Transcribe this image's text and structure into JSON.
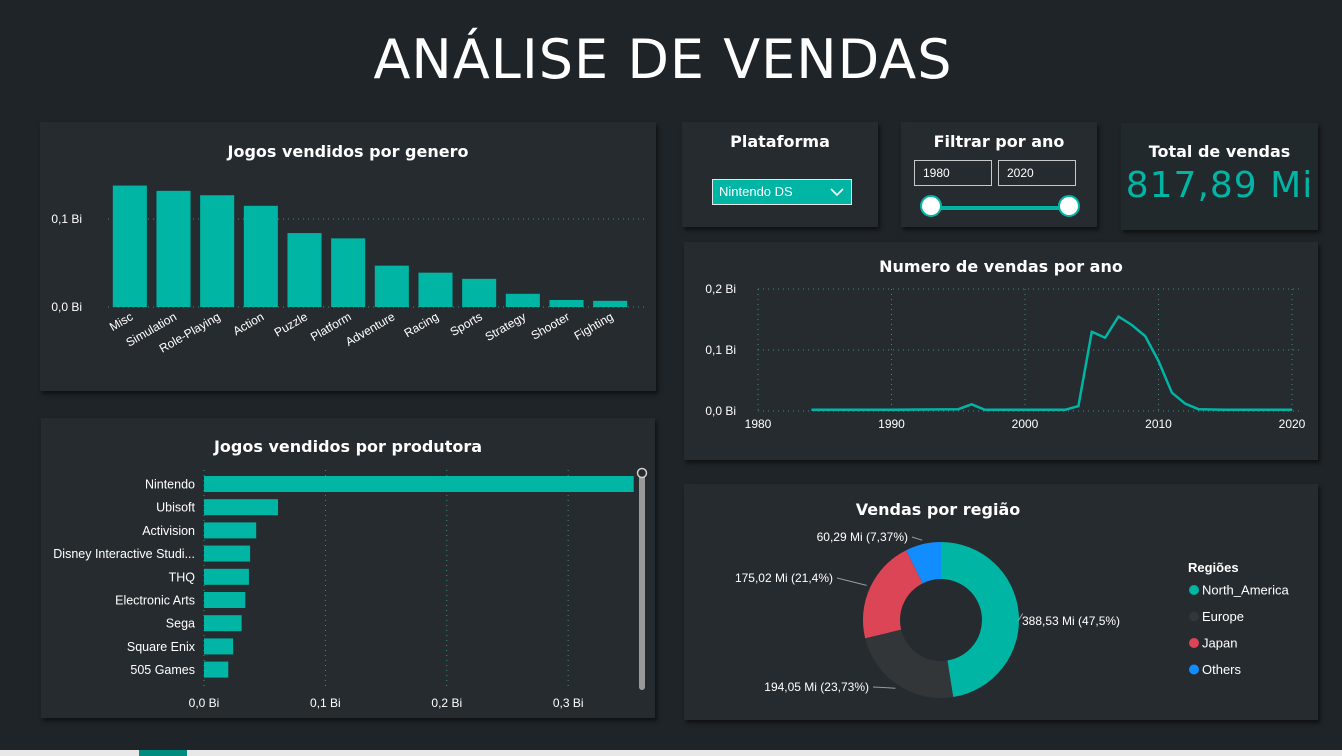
{
  "page_title": "ANÁLISE DE VENDAS",
  "colors": {
    "accent": "#00b5a4",
    "background": "#1f2428",
    "card": "#262b30"
  },
  "platform_filter": {
    "title": "Plataforma",
    "selected": "Nintendo DS",
    "icon": "chevron-down-icon"
  },
  "year_filter": {
    "title": "Filtrar por ano",
    "from": "1980",
    "to": "2020",
    "range": [
      1980,
      2020
    ]
  },
  "kpi": {
    "title": "Total de vendas",
    "value": "817,89 Mi"
  },
  "chart_data": [
    {
      "id": "genre",
      "type": "bar",
      "title": "Jogos vendidos por genero",
      "categories": [
        "Misc",
        "Simulation",
        "Role-Playing",
        "Action",
        "Puzzle",
        "Platform",
        "Adventure",
        "Racing",
        "Sports",
        "Strategy",
        "Shooter",
        "Fighting"
      ],
      "values": [
        0.138,
        0.132,
        0.127,
        0.115,
        0.084,
        0.078,
        0.047,
        0.039,
        0.032,
        0.015,
        0.008,
        0.007
      ],
      "yticks": [
        "0,0 Bi",
        "0,1 Bi"
      ],
      "ylim": [
        0,
        0.14
      ],
      "grid": true
    },
    {
      "id": "publisher",
      "type": "bar",
      "orientation": "horizontal",
      "title": "Jogos vendidos por produtora",
      "categories": [
        "Nintendo",
        "Ubisoft",
        "Activision",
        "Disney Interactive Studi...",
        "THQ",
        "Electronic Arts",
        "Sega",
        "Square Enix",
        "505 Games"
      ],
      "values": [
        0.354,
        0.061,
        0.043,
        0.038,
        0.037,
        0.034,
        0.031,
        0.024,
        0.02
      ],
      "xticks": [
        "0,0 Bi",
        "0,1 Bi",
        "0,2 Bi",
        "0,3 Bi"
      ],
      "xlim": [
        0,
        0.36
      ],
      "grid": true
    },
    {
      "id": "year",
      "type": "line",
      "title": "Numero de vendas por ano",
      "x": [
        1984,
        1985,
        1990,
        1995,
        1996,
        1997,
        2000,
        2003,
        2004,
        2005,
        2006,
        2007,
        2008,
        2009,
        2010,
        2011,
        2012,
        2013,
        2015,
        2020
      ],
      "y": [
        0.002,
        0.002,
        0.002,
        0.003,
        0.011,
        0.002,
        0.002,
        0.002,
        0.008,
        0.13,
        0.12,
        0.155,
        0.141,
        0.123,
        0.082,
        0.03,
        0.012,
        0.003,
        0.002,
        0.002
      ],
      "xticks": [
        "1980",
        "1990",
        "2000",
        "2010",
        "2020"
      ],
      "yticks": [
        "0,0 Bi",
        "0,1 Bi",
        "0,2 Bi"
      ],
      "xlim": [
        1980,
        2020
      ],
      "ylim": [
        0,
        0.2
      ],
      "grid": true
    },
    {
      "id": "region",
      "type": "pie",
      "style": "donut",
      "title": "Vendas por região",
      "legend_title": "Regiões",
      "legend_position": "right",
      "slices": [
        {
          "name": "North_America",
          "value": 388.53,
          "label": "388,53 Mi (47,5%)",
          "color": "#00b5a4"
        },
        {
          "name": "Europe",
          "value": 194.05,
          "label": "194,05 Mi (23,73%)",
          "color": "#333638"
        },
        {
          "name": "Japan",
          "value": 175.02,
          "label": "175,02 Mi (21,4%)",
          "color": "#dc4556"
        },
        {
          "name": "Others",
          "value": 60.29,
          "label": "60,29 Mi (7,37%)",
          "color": "#118dff"
        }
      ]
    }
  ]
}
